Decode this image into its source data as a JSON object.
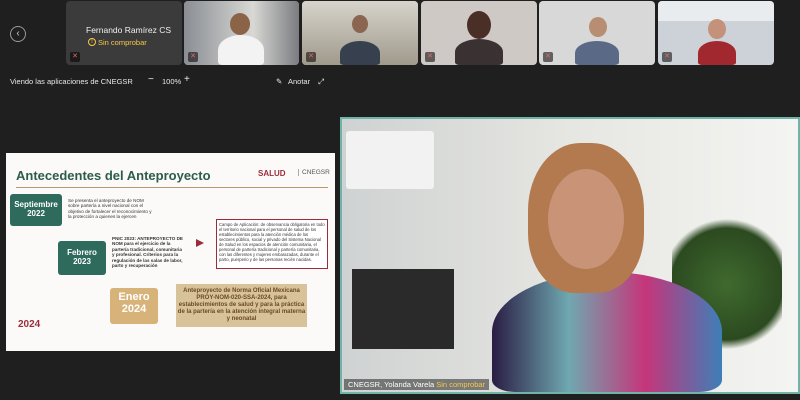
{
  "participants": [
    {
      "name": "Fernando Ramírez CS",
      "status": "Sin comprobar"
    },
    {
      "label": "participant-2"
    },
    {
      "label": "participant-3"
    },
    {
      "label": "participant-4"
    },
    {
      "label": "participant-5"
    },
    {
      "label": "participant-6"
    },
    {
      "label": "participant-7"
    }
  ],
  "toolbar": {
    "viewing": "Viendo las aplicaciones de CNEGSR",
    "zoom_out": "−",
    "zoom": "100%",
    "zoom_in": "+",
    "annotate": "Anotar"
  },
  "slide": {
    "title": "Antecedentes del Anteproyecto",
    "brand": "SALUD",
    "org": "CNEGSR",
    "entries": [
      {
        "date": "Septiembre 2022",
        "text": "Se presenta el anteproyecto de NOM sobre partería a nivel nacional con el objetivo de fortalecer el reconocimiento y la protección a quienes la ejercen"
      },
      {
        "date": "Febrero 2023",
        "text": "PNIC 2023: ANTEPROYECTO DE NOM para el ejercicio de la partería tradicional, comunitaria y profesional. Criterios para la regulación de las salas de labor, parto y recuperación"
      },
      {
        "date": "Enero 2024",
        "text": ""
      }
    ],
    "scope": "Campo de Aplicación: de observancia obligatoria en todo el territorio nacional para el personal de salud de los establecimientos para la atención médica de los sectores público, social y privado del Sistema Nacional de Salud en los espacios de atención comunitaria, el personal de partería tradicional y partería comunitaria, con las diferentes y mujeres embarazadas, durante el parto, puerperio y de las personas recién nacidas.",
    "final": "Anteproyecto de Norma Oficial Mexicana PROY-NOM-020-SSA-2024, para establecimientos de salud y para la práctica de la partería en la atención integral materna y neonatal",
    "logo": "2024"
  },
  "presenter": {
    "name": "CNEGSR, Yolanda Varela",
    "status": "Sin comprobar"
  }
}
